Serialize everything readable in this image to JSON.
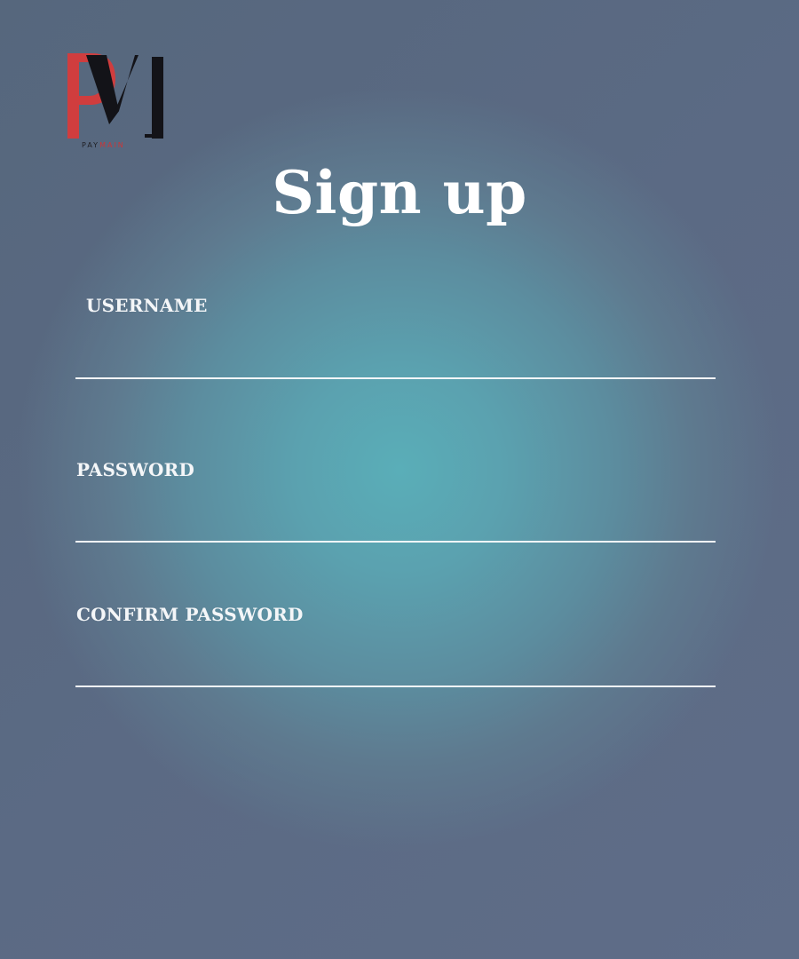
{
  "logo": {
    "letters": "PM",
    "caption_prefix": "PAY",
    "caption_accent": "MAIN",
    "colors": {
      "red": "#d03d3e",
      "black": "#131318"
    }
  },
  "page": {
    "title": "Sign up"
  },
  "form": {
    "username": {
      "label": "USERNAME",
      "value": ""
    },
    "password": {
      "label": "PASSWORD",
      "value": ""
    },
    "confirm_password": {
      "label": "CONFIRM PASSWORD",
      "value": ""
    }
  }
}
